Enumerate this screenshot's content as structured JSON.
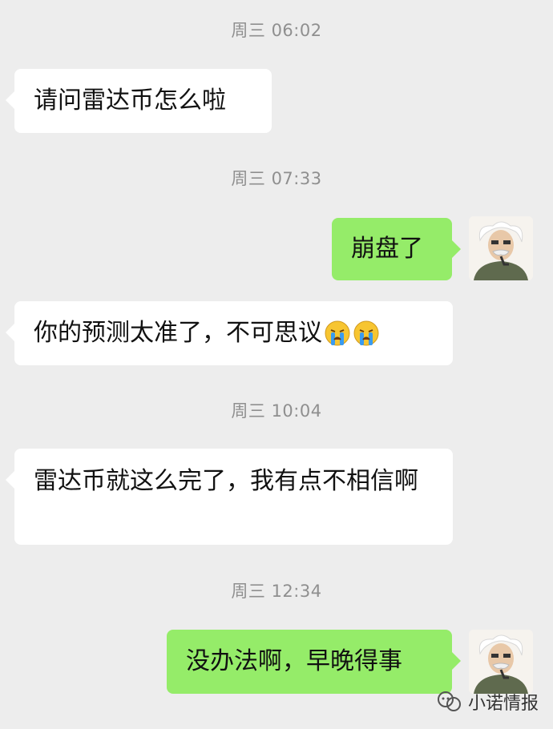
{
  "messages": [
    {
      "type": "time",
      "text": "周三 06:02"
    },
    {
      "type": "incoming",
      "text": "请问雷达币怎么啦"
    },
    {
      "type": "time",
      "text": "周三 07:33"
    },
    {
      "type": "outgoing",
      "text": "崩盘了"
    },
    {
      "type": "incoming",
      "text": "你的预测太准了，不可思议",
      "emoji": [
        "crying-face",
        "crying-face"
      ]
    },
    {
      "type": "time",
      "text": "周三 10:04"
    },
    {
      "type": "incoming",
      "text": "雷达币就这么完了，我有点不相信啊"
    },
    {
      "type": "time",
      "text": "周三 12:34"
    },
    {
      "type": "outgoing",
      "text": "没办法啊，早晚得事"
    }
  ],
  "watermark": {
    "text": "小诺情报",
    "icon": "wechat-channel-icon"
  },
  "colors": {
    "background": "#ededed",
    "incoming": "#ffffff",
    "outgoing": "#95ec69",
    "timestamp": "#8f8f8f"
  }
}
